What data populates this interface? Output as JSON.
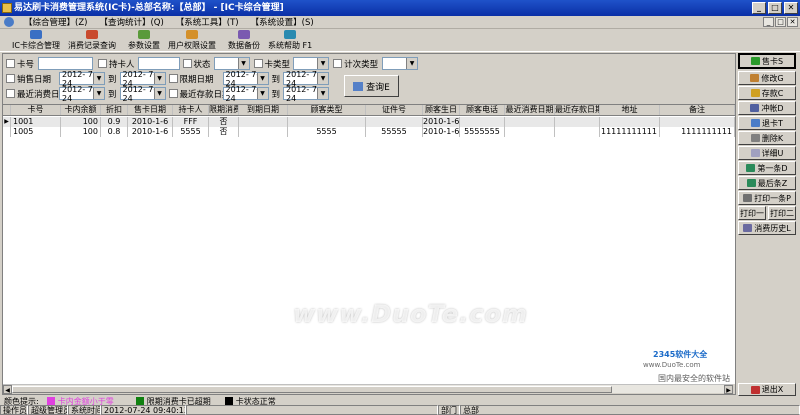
{
  "window": {
    "title": "易达刷卡消费管理系统(IC卡)-总部名称:【总部】 - [IC卡综合管理]",
    "min": "_",
    "max": "□",
    "close": "✕"
  },
  "menu": [
    "【综合管理】(Z)",
    "【查询统计】(Q)",
    "【系统工具】(T)",
    "【系统设置】(S)"
  ],
  "mdi": [
    "_",
    "□",
    "✕"
  ],
  "toolbar": [
    "IC卡综合管理",
    "消费记录查询",
    "参数设置",
    "用户权限设置",
    "数据备份",
    "系统帮助 F1"
  ],
  "colors": {
    "toolbar_icons": [
      "#3a6fc4",
      "#c94a2e",
      "#5a9a3a",
      "#d4902a",
      "#7a5ab0",
      "#2a8ab0"
    ]
  },
  "filters": {
    "row1": {
      "card_no": "卡号",
      "holder": "持卡人",
      "status": "状态",
      "card_type": "卡类型",
      "count_type": "计次类型"
    },
    "row2": {
      "sale_date": "销售日期",
      "date_from": "2012- 7-24",
      "to": "到",
      "date_to": "2012- 7-24",
      "limit_date": "限期日期",
      "limit_from": "2012- 7-24",
      "limit_to": "2012- 7-24"
    },
    "row3": {
      "recent_spend": "最近消费日期",
      "spend_from": "2012- 7-24",
      "to": "到",
      "spend_to": "2012- 7-24",
      "recent_deposit": "最近存款日期",
      "dep_from": "2012- 7-24",
      "dep_to": "2012- 7-24"
    },
    "query_button": "查询E"
  },
  "table": {
    "headers": [
      "卡号",
      "卡内余额",
      "折扣",
      "售卡日期",
      "持卡人",
      "限期消费",
      "到期日期",
      "顾客类型",
      "证件号",
      "顾客生日",
      "顾客电话",
      "最近消费日期",
      "最近存款日期",
      "地址",
      "备注"
    ],
    "rows": [
      [
        "1001",
        "100",
        "0.9",
        "2010-1-6",
        "FFF",
        "否",
        "",
        "",
        "",
        "2010-1-6",
        "",
        "",
        "",
        "",
        ""
      ],
      [
        "1005",
        "100",
        "0.8",
        "2010-1-6",
        "5555",
        "否",
        "",
        "5555",
        "55555",
        "2010-1-6",
        "5555555",
        "",
        "",
        "11111111111",
        "1111111111"
      ]
    ],
    "summary": {
      "count": "2",
      "balance": "200"
    }
  },
  "side_buttons": [
    "售卡S",
    "修改G",
    "存款C",
    "冲帐D",
    "退卡T",
    "删除K",
    "详细U",
    "第一条D",
    "最后条Z",
    "打印一条P",
    "打印一",
    "打印二",
    "消费历史L"
  ],
  "exit_button": "退出X",
  "legend": {
    "label": "颜色提示:",
    "items": [
      {
        "text": "卡内金额小于零",
        "color": "#e040e0"
      },
      {
        "text": "限期消费卡已超期",
        "color": "#108010"
      },
      {
        "text": "卡状态正常",
        "color": "#000000"
      }
    ]
  },
  "status": [
    "操作员",
    "超级管理员",
    "系统时间",
    "2012-07-24 09:40:13",
    "",
    "部门",
    "总部"
  ],
  "watermark": "www.DuoTe.com",
  "corner_logo": "2345软件大全",
  "corner_text": "国内最安全的软件站",
  "corner_url": "www.DuoTe.com"
}
